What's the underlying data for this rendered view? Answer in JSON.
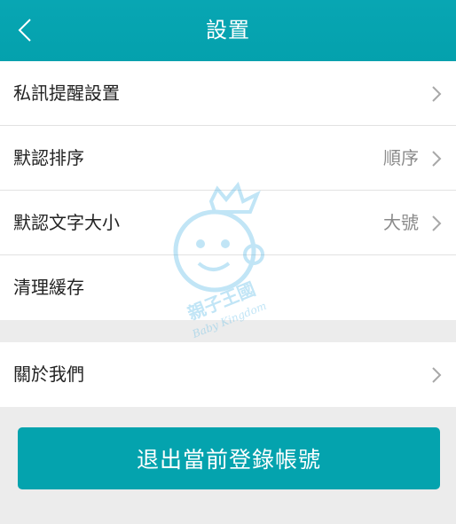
{
  "header": {
    "title": "設置",
    "back_icon": "chevron-left-icon"
  },
  "settings": {
    "notification": {
      "label": "私訊提醒設置"
    },
    "sort": {
      "label": "默認排序",
      "value": "順序"
    },
    "font_size": {
      "label": "默認文字大小",
      "value": "大號"
    },
    "clear_cache": {
      "label": "清理緩存"
    }
  },
  "about": {
    "label": "關於我們"
  },
  "logout": {
    "label": "退出當前登錄帳號"
  },
  "watermark": {
    "brand": "親子王國",
    "brand_en": "Baby Kingdom"
  },
  "colors": {
    "accent": "#04a3ae",
    "background": "#ececec",
    "value_text": "#8a8a8a"
  }
}
